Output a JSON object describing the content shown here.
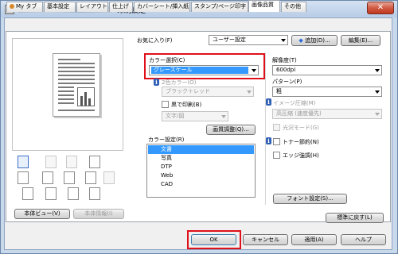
{
  "window": {
    "title": "印刷設定",
    "close_label": "✕"
  },
  "tabs": [
    {
      "label": "My タブ"
    },
    {
      "label": "基本設定"
    },
    {
      "label": "レイアウト"
    },
    {
      "label": "仕上げ"
    },
    {
      "label": "カバーシート/挿入紙"
    },
    {
      "label": "スタンプ/ページ印字"
    },
    {
      "label": "画像品質"
    },
    {
      "label": "その他"
    }
  ],
  "favorites": {
    "label": "お気に入り(F)",
    "value": "ユーザー設定",
    "add_label": "追加(D)...",
    "edit_label": "編集(E)..."
  },
  "color_select": {
    "label": "カラー選択(C)",
    "value": "グレースケール"
  },
  "tone": {
    "label": "2色カラー(O)",
    "value": "ブラック＋レッド"
  },
  "black_print": {
    "label": "黒で印刷(B)",
    "value": "文字/図"
  },
  "quality_adjust_label": "画質調整(Q)...",
  "color_settings": {
    "label": "カラー設定(R)",
    "items": [
      "文書",
      "写真",
      "DTP",
      "Web",
      "CAD"
    ],
    "selected": 0
  },
  "resolution": {
    "label": "解像度(T)",
    "value": "600dpi"
  },
  "pattern": {
    "label": "パターン(P)",
    "value": "粗"
  },
  "image_compression": {
    "label": "イメージ圧縮(M)",
    "value": "高圧縮 (速度優先)"
  },
  "glossy_mode": {
    "label": "光沢モード(G)"
  },
  "toner_save": {
    "label": "トナー節約(N)"
  },
  "edge_emphasis": {
    "label": "エッジ強調(H)"
  },
  "font_settings_label": "フォント設定(S)...",
  "view_label": "本体ビュー(V)",
  "device_info_label": "本体情報(I)",
  "restore_defaults_label": "標準に戻す(L)",
  "footer": {
    "ok": "OK",
    "cancel": "キャンセル",
    "apply": "適用(A)",
    "help": "ヘルプ"
  }
}
